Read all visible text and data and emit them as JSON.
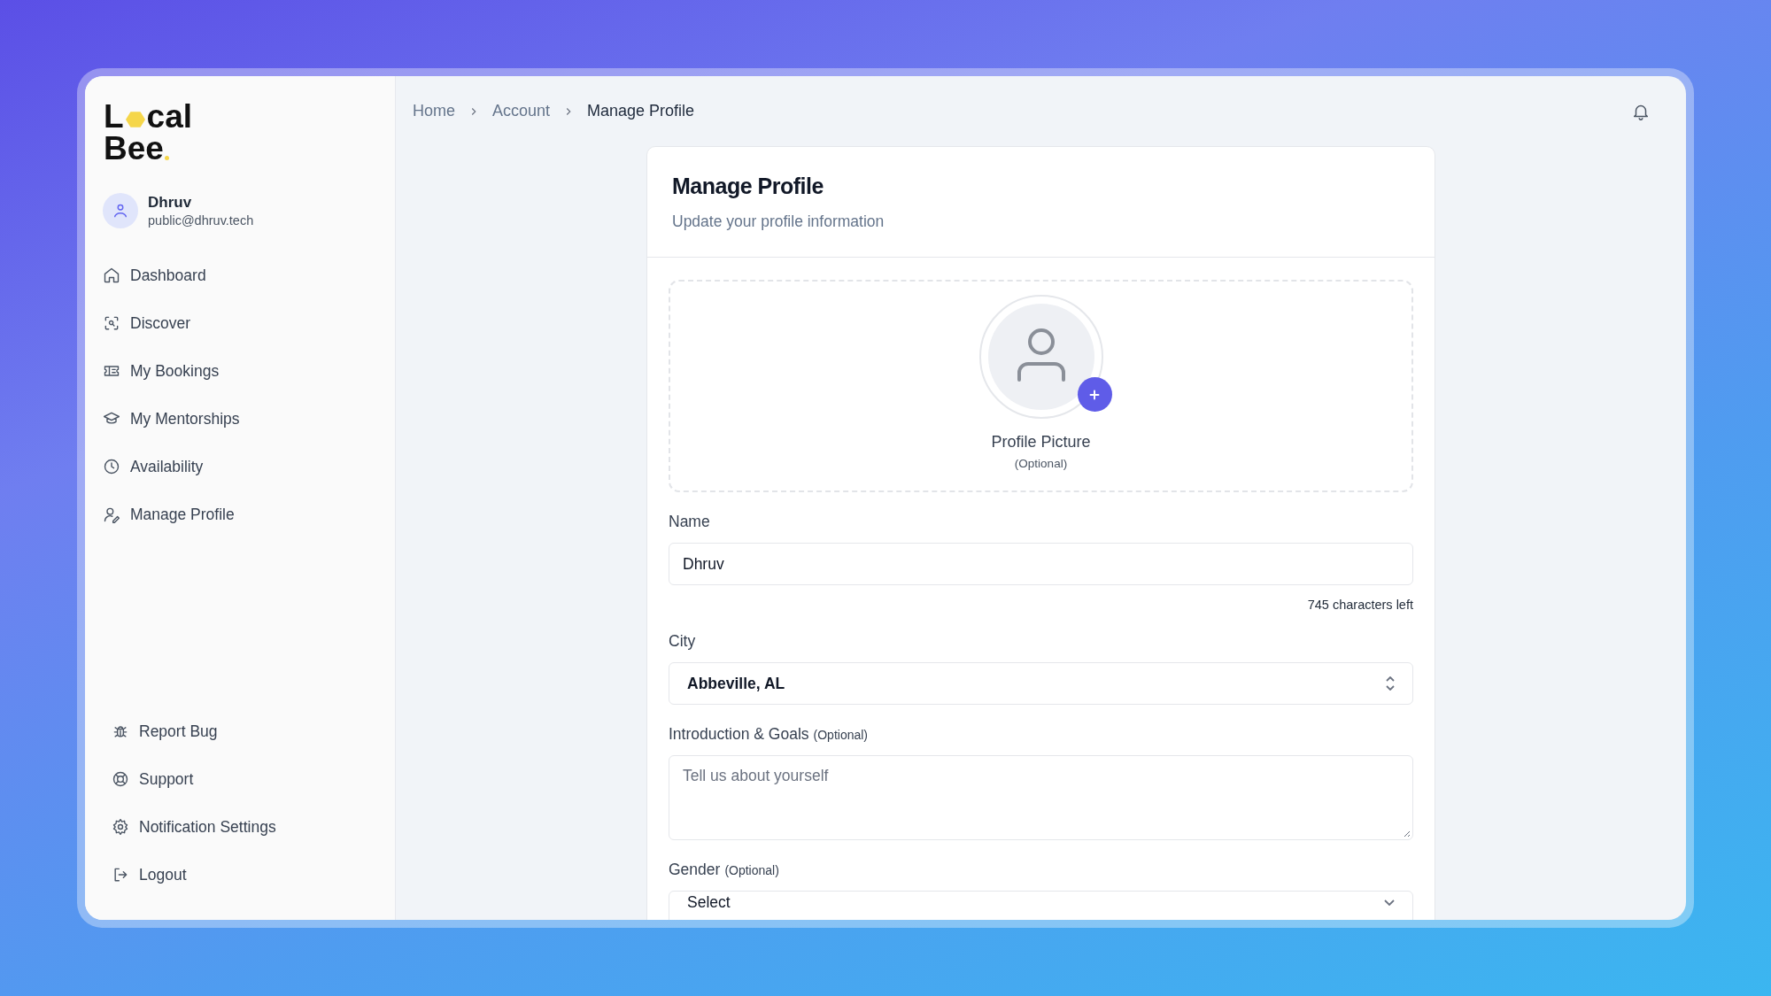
{
  "logo": {
    "first": "L",
    "rest": "cal",
    "second": "Bee"
  },
  "user": {
    "name": "Dhruv",
    "email": "public@dhruv.tech"
  },
  "nav": [
    {
      "label": "Dashboard"
    },
    {
      "label": "Discover"
    },
    {
      "label": "My Bookings"
    },
    {
      "label": "My Mentorships"
    },
    {
      "label": "Availability"
    },
    {
      "label": "Manage Profile"
    }
  ],
  "footer_nav": [
    {
      "label": "Report Bug"
    },
    {
      "label": "Support"
    },
    {
      "label": "Notification Settings"
    },
    {
      "label": "Logout"
    }
  ],
  "breadcrumb": [
    "Home",
    "Account",
    "Manage Profile"
  ],
  "page": {
    "title": "Manage Profile",
    "subtitle": "Update your profile information"
  },
  "picture": {
    "label": "Profile Picture",
    "note": "(Optional)"
  },
  "fields": [
    {
      "kind": "text",
      "label": "Name",
      "value": "Dhruv",
      "counter": "745 characters left"
    },
    {
      "kind": "select",
      "label": "City",
      "value": "Abbeville, AL"
    },
    {
      "kind": "textarea",
      "label": "Introduction & Goals",
      "optional": "(Optional)",
      "placeholder": "Tell us about yourself"
    },
    {
      "kind": "dropdown",
      "label": "Gender",
      "optional": "(Optional)",
      "value": "Select"
    }
  ]
}
